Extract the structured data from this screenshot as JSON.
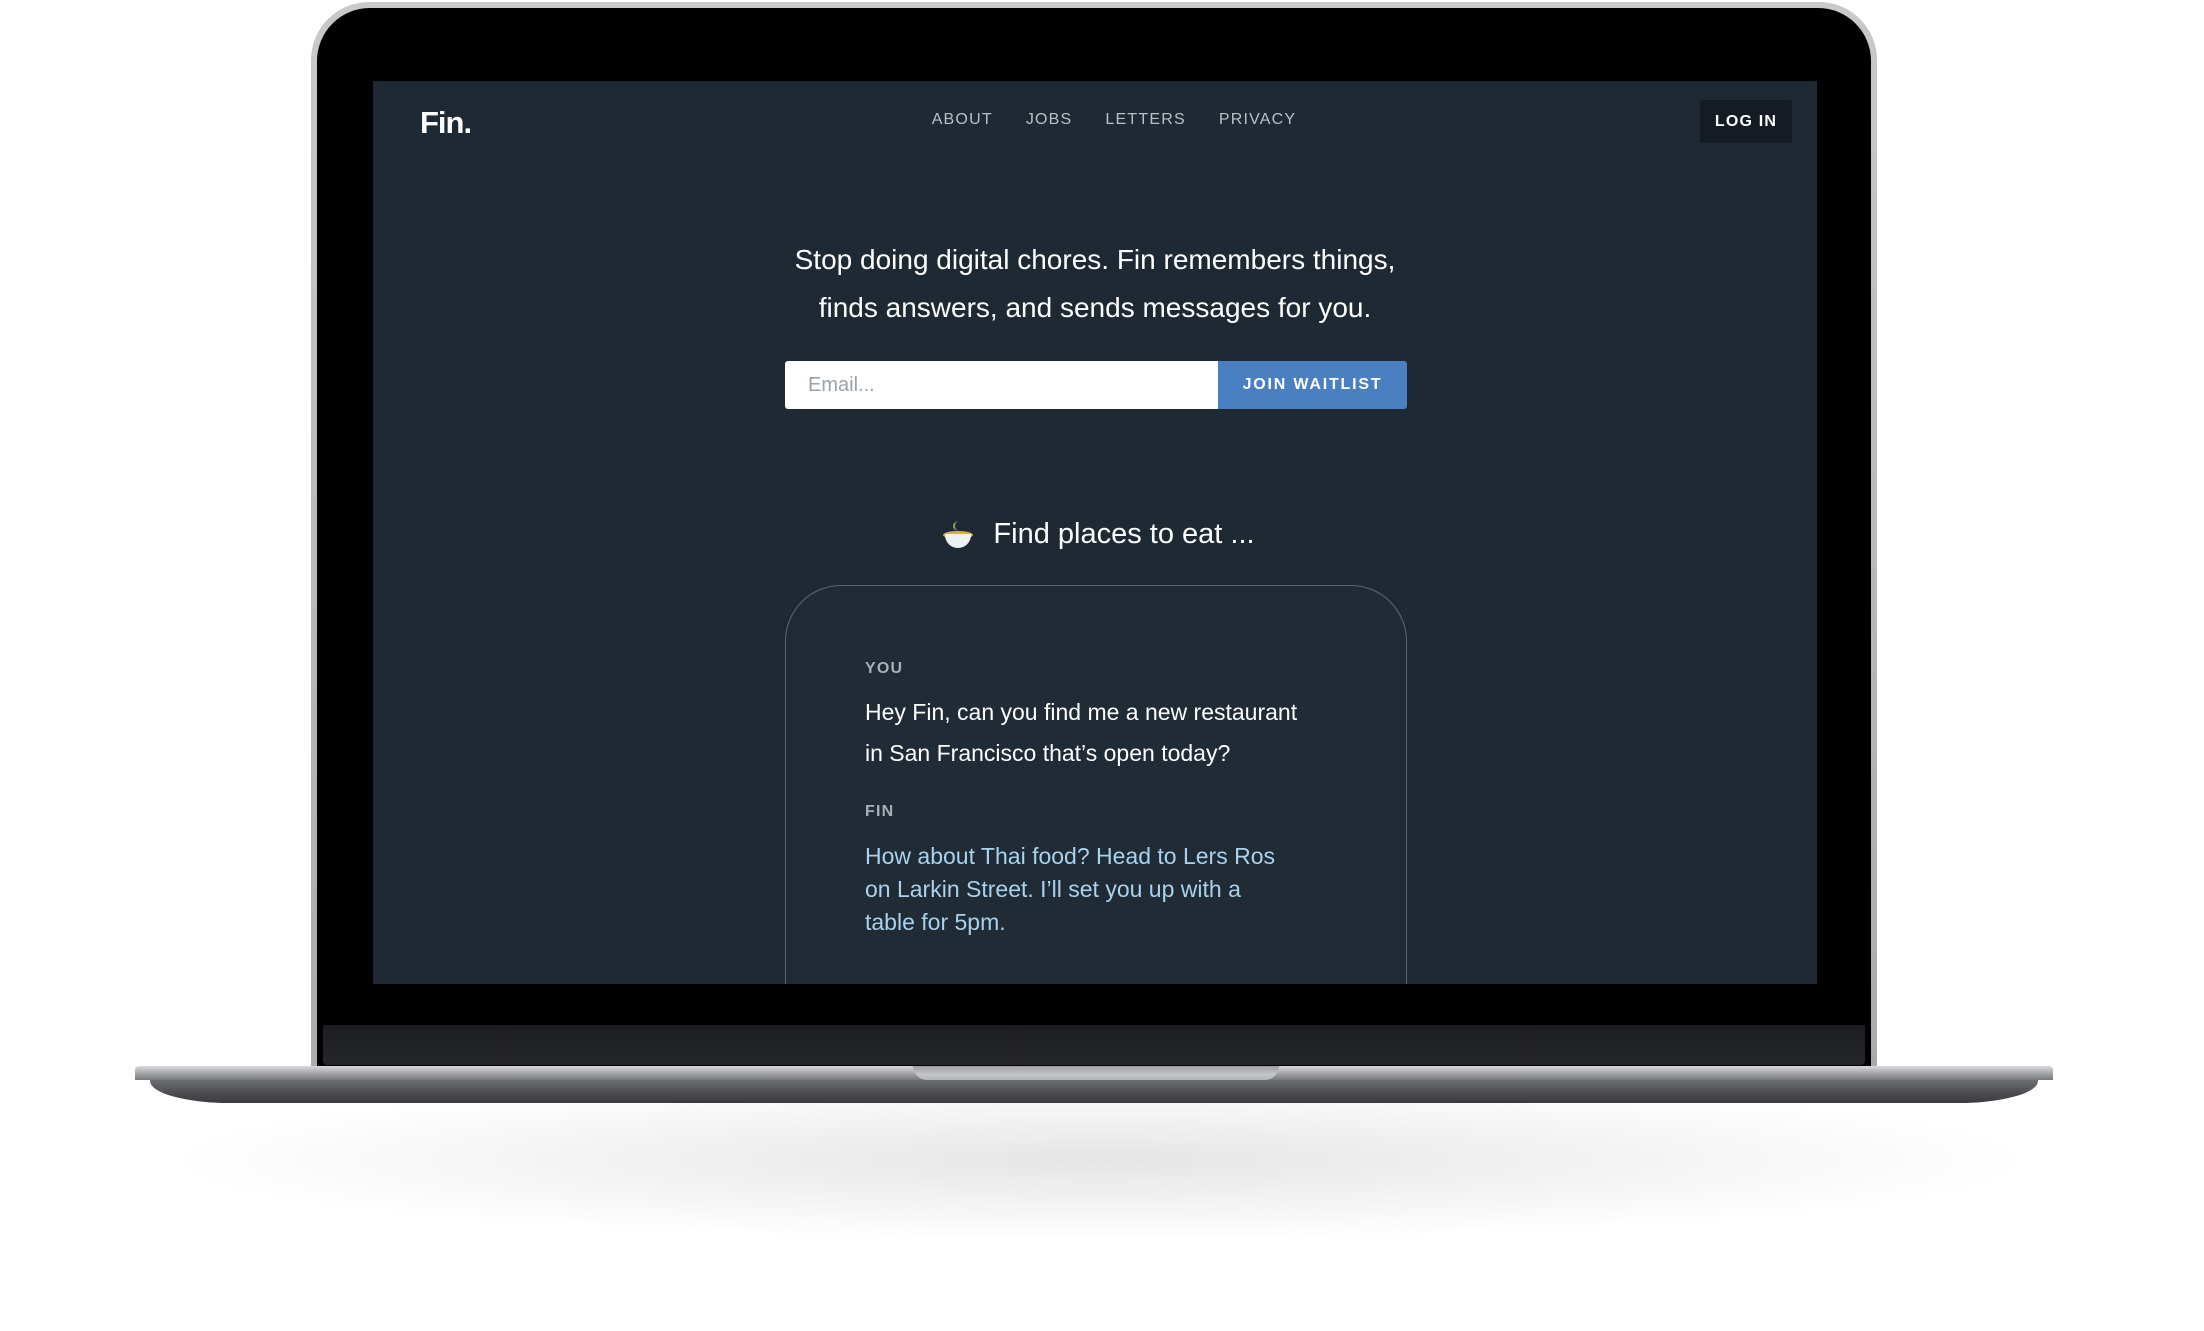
{
  "header": {
    "logo": "Fin.",
    "nav": [
      "ABOUT",
      "JOBS",
      "LETTERS",
      "PRIVACY"
    ],
    "login_label": "LOG IN"
  },
  "hero": {
    "tagline_line1": "Stop doing digital chores. Fin remembers things,",
    "tagline_line2": "finds answers, and sends messages for you.",
    "email_placeholder": "Email...",
    "join_label": "JOIN WAITLIST"
  },
  "feature": {
    "icon": "bowl-icon",
    "title": "Find places to eat ..."
  },
  "conversation": {
    "you_label": "YOU",
    "you_line1": "Hey Fin, can you find me a new restaurant",
    "you_line2": "in San Francisco that’s open today?",
    "fin_label": "FIN",
    "fin_line1": "How about Thai food? Head to Lers Ros",
    "fin_line2": "on Larkin Street. I’ll set you up with a",
    "fin_line3": "table for 5pm."
  },
  "colors": {
    "page_background": "#1f2933",
    "accent": "#4a7fc1",
    "fin_reply_text": "#a8d2ee"
  }
}
